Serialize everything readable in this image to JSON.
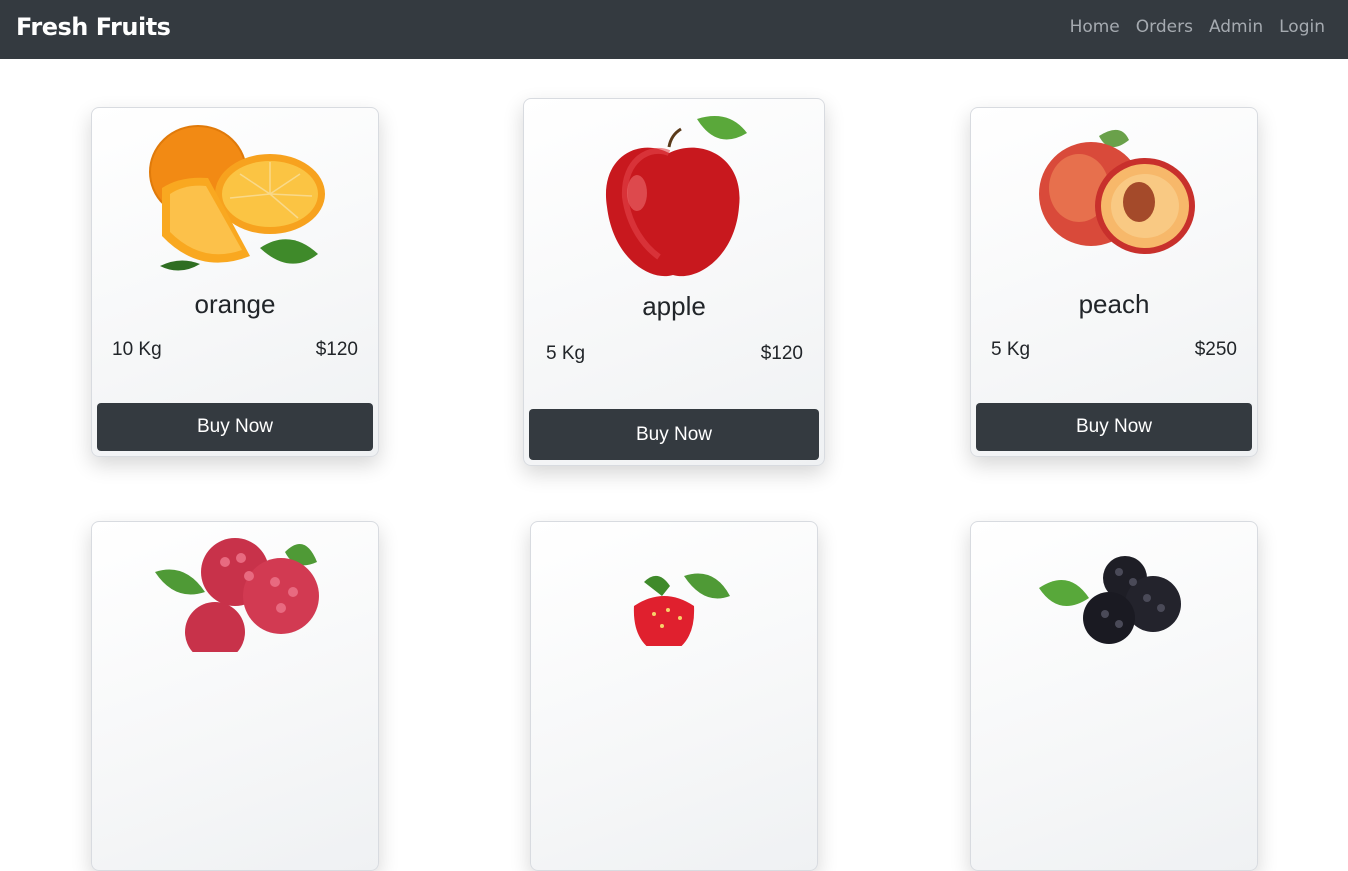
{
  "navbar": {
    "brand": "Fresh Fruits",
    "links": [
      "Home",
      "Orders",
      "Admin",
      "Login"
    ]
  },
  "products": [
    {
      "name": "orange",
      "weight": "10 Kg",
      "price": "$120",
      "button": "Buy Now",
      "image_icon": "orange-icon"
    },
    {
      "name": "apple",
      "weight": "5 Kg",
      "price": "$120",
      "button": "Buy Now",
      "image_icon": "apple-icon"
    },
    {
      "name": "peach",
      "weight": "5 Kg",
      "price": "$250",
      "button": "Buy Now",
      "image_icon": "peach-icon"
    },
    {
      "image_icon": "raspberry-icon"
    },
    {
      "image_icon": "strawberry-icon"
    },
    {
      "image_icon": "blackberry-icon"
    }
  ],
  "colors": {
    "navbar_bg": "#343a40",
    "button_bg": "#343a40",
    "nav_link": "#a5aab0"
  }
}
